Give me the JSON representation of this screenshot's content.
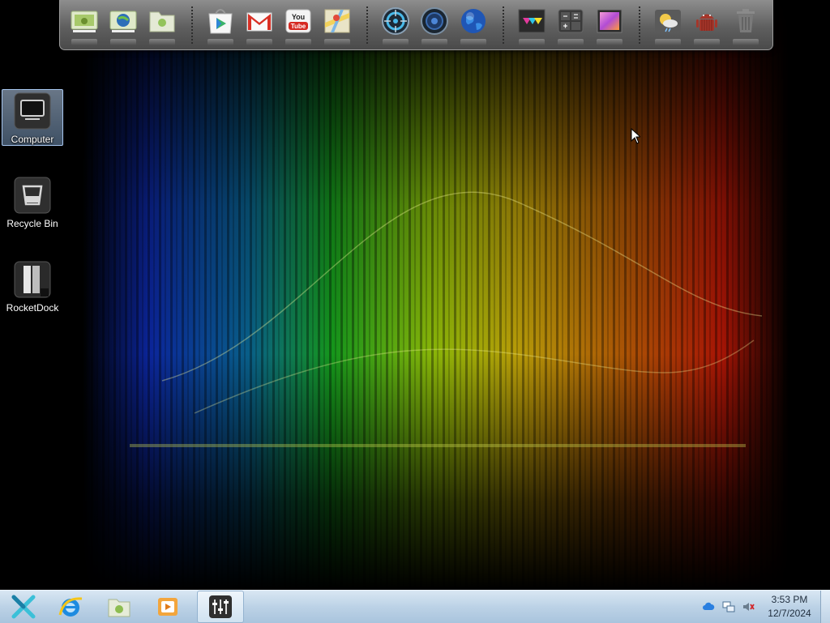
{
  "desktop": {
    "icons": [
      {
        "label": "Computer",
        "icon": "computer-icon",
        "selected": true
      },
      {
        "label": "Recycle Bin",
        "icon": "recycle-bin-icon",
        "selected": false
      },
      {
        "label": "RocketDock",
        "icon": "rocketdock-icon",
        "selected": false
      }
    ]
  },
  "dock": {
    "items": [
      {
        "name": "android-screen-icon"
      },
      {
        "name": "android-globe-icon"
      },
      {
        "name": "android-folder-icon"
      },
      {
        "name": "play-store-icon"
      },
      {
        "name": "gmail-icon"
      },
      {
        "name": "youtube-icon",
        "text": "You Tube"
      },
      {
        "name": "maps-icon"
      },
      {
        "name": "target-icon"
      },
      {
        "name": "speaker-icon"
      },
      {
        "name": "globe-icon"
      },
      {
        "name": "color-palette-icon"
      },
      {
        "name": "calculator-icon"
      },
      {
        "name": "photo-gallery-icon"
      },
      {
        "name": "weather-icon"
      },
      {
        "name": "android-robot-icon"
      },
      {
        "name": "trash-icon"
      }
    ]
  },
  "taskbar": {
    "items": [
      {
        "name": "start-button"
      },
      {
        "name": "internet-explorer-icon"
      },
      {
        "name": "file-manager-icon"
      },
      {
        "name": "media-player-icon"
      },
      {
        "name": "mixer-app-icon",
        "active": true
      }
    ],
    "tray": {
      "time": "3:53 PM",
      "date": "12/7/2024",
      "icons": [
        "cloud-icon",
        "network-icon",
        "volume-muted-icon"
      ]
    }
  },
  "colors": {
    "taskbar_top": "#d9e7f3",
    "taskbar_bottom": "#a9c4dd",
    "dock": "#6a6a6a",
    "selection": "#a7c6ef"
  }
}
